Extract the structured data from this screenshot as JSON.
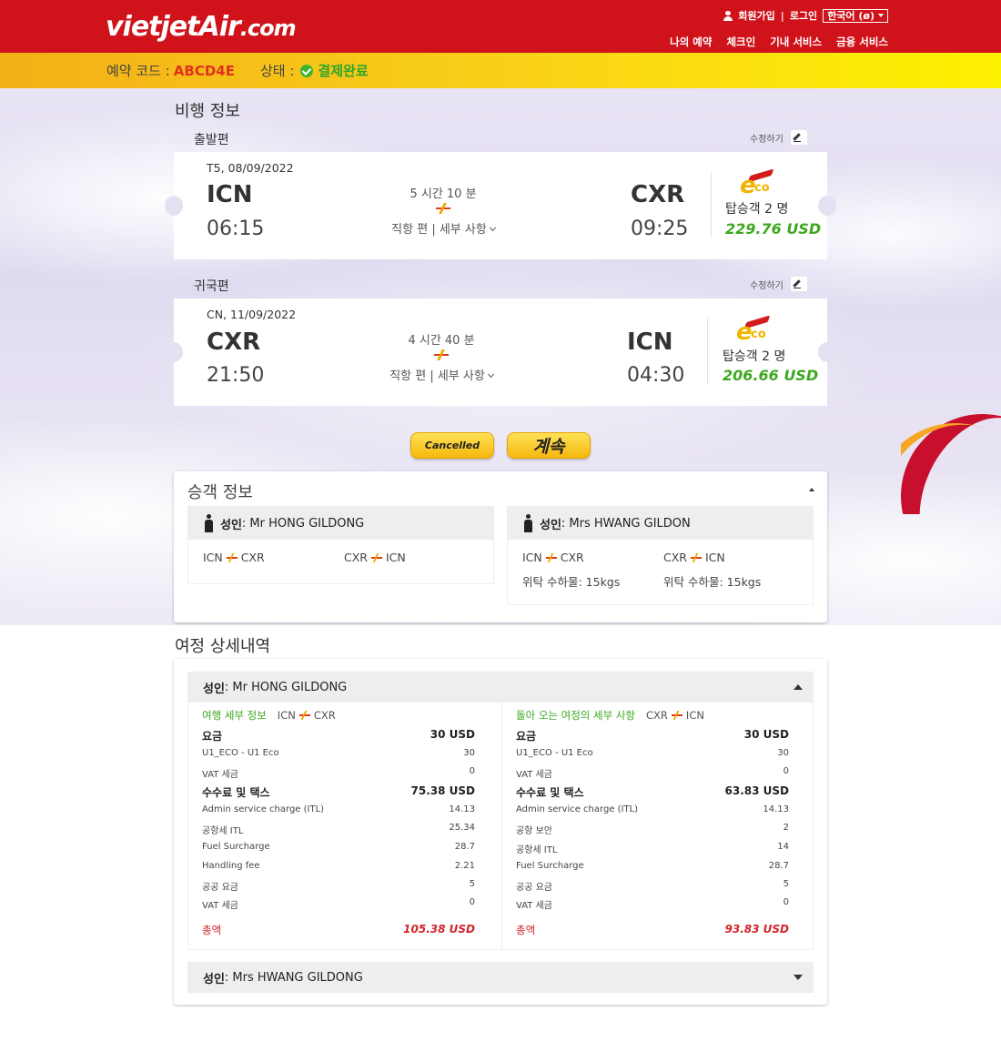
{
  "header": {
    "logo_main": "vietjetAir",
    "logo_suffix": ".com",
    "signup": "회원가입",
    "login": "로그인",
    "language": "한국어 (ø)",
    "nav": [
      "나의 예약",
      "체크인",
      "기내 서비스",
      "금융 서비스"
    ]
  },
  "status_bar": {
    "code_label": "예약 코드 :",
    "code": "ABCD4E",
    "state_label": "상태 :",
    "state": "결제완료"
  },
  "flight_info": {
    "title": "비행 정보",
    "edit_label": "수정하기",
    "outbound": {
      "label": "출발편",
      "date": "T5, 08/09/2022",
      "from_code": "ICN",
      "from_time": "06:15",
      "duration": "5 시간 10 분",
      "details": "직항 편 | 세부 사항",
      "to_code": "CXR",
      "to_time": "09:25",
      "passengers": "탑승객 2 명",
      "price": "229.76 USD"
    },
    "inbound": {
      "label": "귀국편",
      "date": "CN, 11/09/2022",
      "from_code": "CXR",
      "from_time": "21:50",
      "duration": "4 시간 40 분",
      "details": "직항 편 | 세부 사항",
      "to_code": "ICN",
      "to_time": "04:30",
      "passengers": "탑승객 2 명",
      "price": "206.66 USD"
    }
  },
  "buttons": {
    "cancel": "Cancelled",
    "continue": "계속"
  },
  "passenger_info": {
    "title": "승객 정보",
    "passengers": [
      {
        "type": "성인",
        "name": ": Mr HONG GILDONG",
        "routes": [
          {
            "from": "ICN",
            "to": "CXR",
            "bag": ""
          },
          {
            "from": "CXR",
            "to": "ICN",
            "bag": ""
          }
        ]
      },
      {
        "type": "성인",
        "name": ": Mrs HWANG GILDON",
        "routes": [
          {
            "from": "ICN",
            "to": "CXR",
            "bag": "위탁 수하물: 15kgs"
          },
          {
            "from": "CXR",
            "to": "ICN",
            "bag": "위탁 수하물: 15kgs"
          }
        ]
      }
    ]
  },
  "itinerary": {
    "title": "여정 상세내역",
    "pax1_type": "성인",
    "pax1_name": ": Mr HONG GILDONG",
    "pax2_type": "성인",
    "pax2_name": ": Mrs HWANG GILDONG",
    "outbound": {
      "title": "여행 세부 정보",
      "from": "ICN",
      "to": "CXR",
      "fare_label": "요금",
      "fare": "30 USD",
      "fare_items": [
        {
          "label": "U1_ECO - U1 Eco",
          "value": "30"
        },
        {
          "label": "VAT 세금",
          "value": "0"
        }
      ],
      "fee_label": "수수료 및 택스",
      "fee": "75.38 USD",
      "fee_items": [
        {
          "label": "Admin service charge (ITL)",
          "value": "14.13"
        },
        {
          "label": "공항세 ITL",
          "value": "25.34"
        },
        {
          "label": "Fuel Surcharge",
          "value": "28.7"
        },
        {
          "label": "Handling fee",
          "value": "2.21"
        },
        {
          "label": "공공 요금",
          "value": "5"
        },
        {
          "label": "VAT 세금",
          "value": "0"
        }
      ],
      "total_label": "총액",
      "total": "105.38 USD"
    },
    "inbound": {
      "title": "돌아 오는 여정의 세부 사항",
      "from": "CXR",
      "to": "ICN",
      "fare_label": "요금",
      "fare": "30 USD",
      "fare_items": [
        {
          "label": "U1_ECO - U1 Eco",
          "value": "30"
        },
        {
          "label": "VAT 세금",
          "value": "0"
        }
      ],
      "fee_label": "수수료 및 택스",
      "fee": "63.83 USD",
      "fee_items": [
        {
          "label": "Admin service charge (ITL)",
          "value": "14.13"
        },
        {
          "label": "공항 보안",
          "value": "2"
        },
        {
          "label": "공항세 ITL",
          "value": "14"
        },
        {
          "label": "Fuel Surcharge",
          "value": "28.7"
        },
        {
          "label": "공공 요금",
          "value": "5"
        },
        {
          "label": "VAT 세금",
          "value": "0"
        }
      ],
      "total_label": "총액",
      "total": "93.83 USD"
    }
  }
}
